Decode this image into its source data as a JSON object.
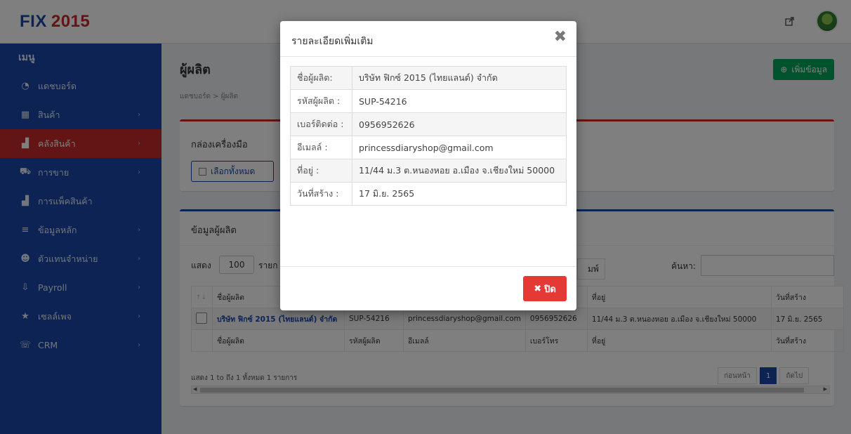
{
  "header": {
    "logo_fix": "FIX",
    "logo_year": "2015",
    "share_icon": "share-icon",
    "avatar": "avatar"
  },
  "sidebar": {
    "title": "เมนู",
    "items": [
      {
        "label": "แดชบอร์ด",
        "icon": "dashboard-icon",
        "glyph": "◔",
        "arrow": ""
      },
      {
        "label": "สินค้า",
        "icon": "products-icon",
        "glyph": "▦",
        "arrow": "›"
      },
      {
        "label": "คลังสินค้า",
        "icon": "warehouse-icon",
        "glyph": "▟",
        "arrow": "›",
        "active": true
      },
      {
        "label": "การขาย",
        "icon": "cart-icon",
        "glyph": "⛟",
        "arrow": "›"
      },
      {
        "label": "การแพ็คสินค้า",
        "icon": "packing-icon",
        "glyph": "▟",
        "arrow": ""
      },
      {
        "label": "ข้อมูลหลัก",
        "icon": "database-icon",
        "glyph": "≡",
        "arrow": "›"
      },
      {
        "label": "ตัวแทนจำหน่าย",
        "icon": "agents-icon",
        "glyph": "☻",
        "arrow": "›"
      },
      {
        "label": "Payroll",
        "icon": "payroll-icon",
        "glyph": "⇩",
        "arrow": "›"
      },
      {
        "label": "เซลล์เพจ",
        "icon": "star-icon",
        "glyph": "★",
        "arrow": "›"
      },
      {
        "label": "CRM",
        "icon": "crm-icon",
        "glyph": "☏",
        "arrow": "›"
      }
    ]
  },
  "page": {
    "title": "ผู้ผลิต",
    "add_button": "เพิ่มข้อมูล",
    "breadcrumb": "แดชบอร์ด > ผู้ผลิต",
    "toolbox_title": "กล่องเครื่องมือ",
    "select_all": "เลือกทั้งหมด"
  },
  "datatable": {
    "title": "ข้อมูลผู้ผลิต",
    "show_label": "แสดง",
    "page_length": "100",
    "show_label_after": "รายก",
    "print_label": "มพ์",
    "search_label": "ค้นหา:",
    "headers": [
      "ชื่อผู้ผลิต",
      "",
      "",
      "",
      "ที่อยู่",
      "วันที่สร้าง"
    ],
    "row": [
      "บริษัท ฟิกซ์ 2015 (ไทยแลนด์) จำกัด",
      "SUP-54216",
      "princessdiaryshop@gmail.com",
      "0956952626",
      "11/44 ม.3 ต.หนองหอย อ.เมือง จ.เชียงใหม่ 50000",
      "17 มิ.ย. 2565"
    ],
    "footers": [
      "ชื่อผู้ผลิต",
      "รหัสผู้ผลิต",
      "อีเมลล์",
      "เบอร์โทร",
      "ที่อยู่",
      "วันที่สร้าง"
    ],
    "info": "แสดง 1 to ถึง 1 ทั้งหมด 1 รายการ",
    "prev": "ก่อนหน้า",
    "current_page": "1",
    "next": "ถัดไป"
  },
  "modal": {
    "title": "รายละเอียดเพิ่มเติม",
    "rows": [
      {
        "key": "ชื่อผู้ผลิต:",
        "value": "บริษัท ฟิกซ์ 2015 (ไทยแลนด์) จำกัด"
      },
      {
        "key": "รหัสผู้ผลิต :",
        "value": "SUP-54216"
      },
      {
        "key": "เบอร์ติดต่อ :",
        "value": "0956952626"
      },
      {
        "key": "อีเมลล์ :",
        "value": "princessdiaryshop@gmail.com"
      },
      {
        "key": "ที่อยู่ :",
        "value": "11/44 ม.3 ต.หนองหอย อ.เมือง จ.เชียงใหม่ 50000"
      },
      {
        "key": "วันที่สร้าง :",
        "value": "17 มิ.ย. 2565"
      }
    ],
    "close_button": "ปิด"
  }
}
